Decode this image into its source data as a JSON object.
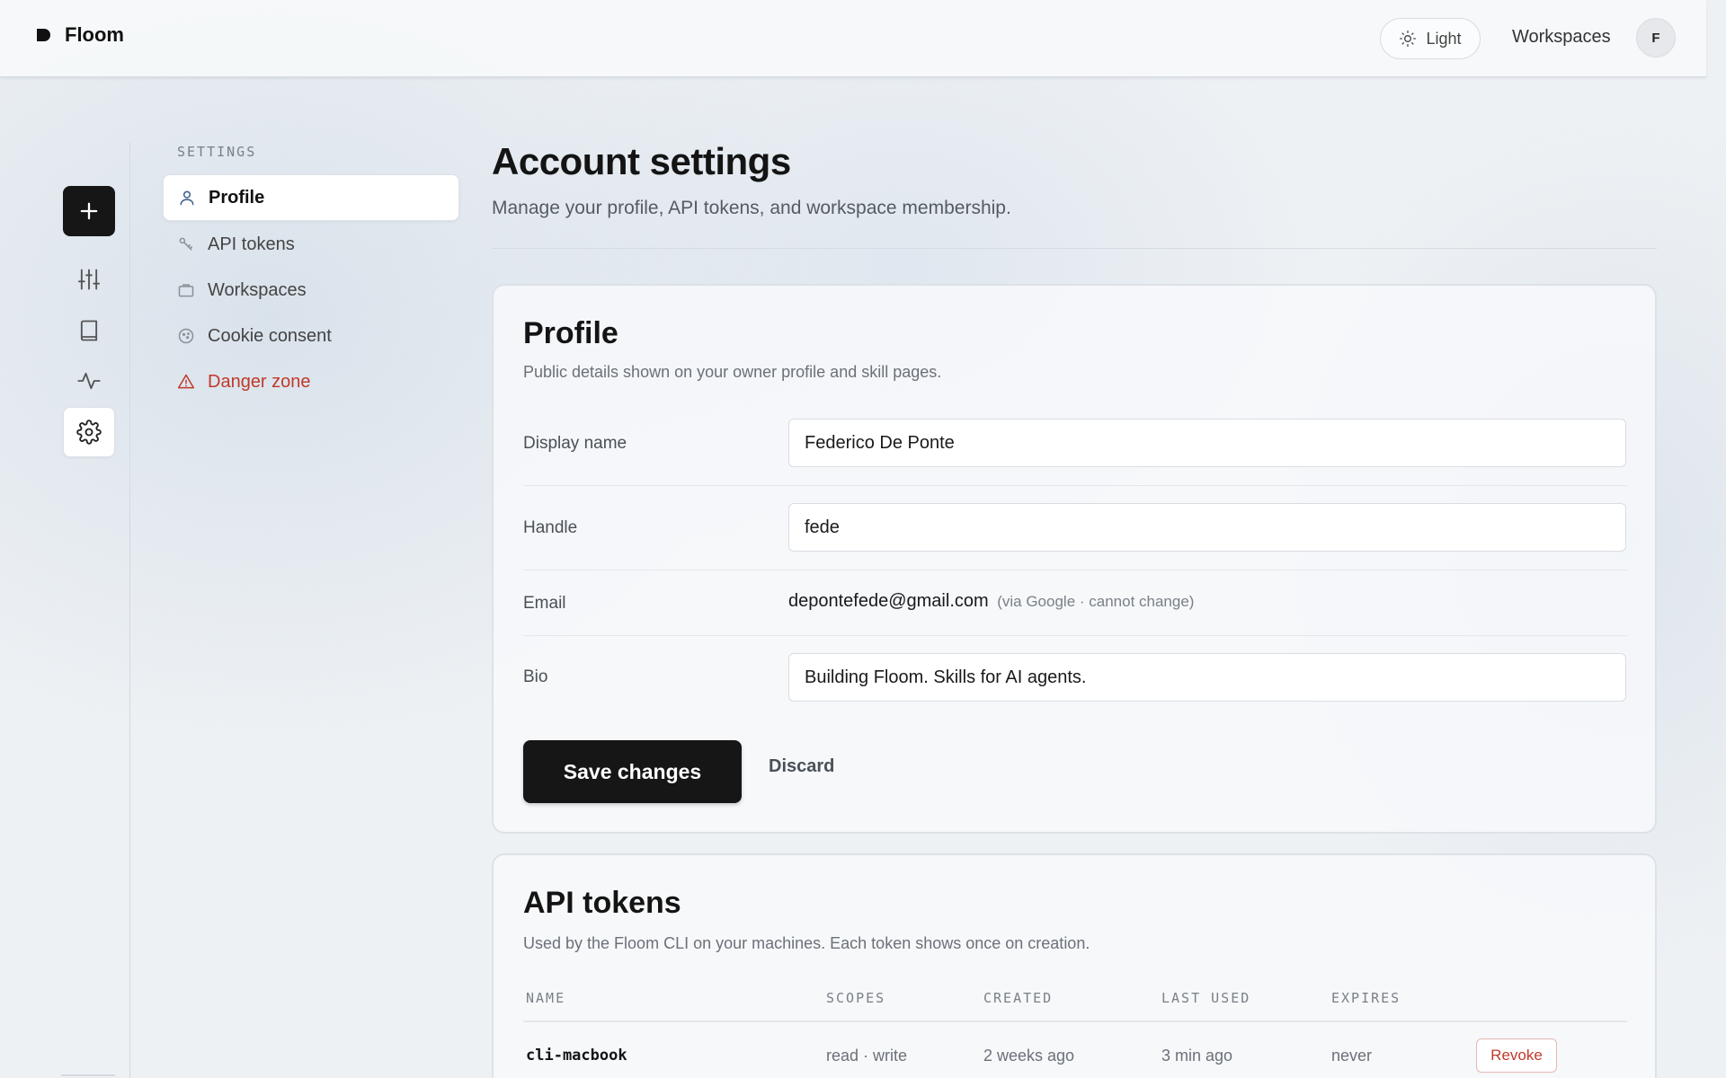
{
  "app": {
    "name": "Floom"
  },
  "topbar": {
    "theme_label": "Light",
    "workspaces_link": "Workspaces",
    "avatar_initial": "F"
  },
  "rail": {
    "items": [
      "new-icon",
      "sliders-icon",
      "book-icon",
      "activity-icon",
      "gear-icon"
    ],
    "active": "gear-icon"
  },
  "settings_nav": {
    "section_label": "SETTINGS",
    "items": [
      {
        "label": "Profile",
        "icon": "user-icon",
        "active": true
      },
      {
        "label": "API tokens",
        "icon": "key-icon"
      },
      {
        "label": "Workspaces",
        "icon": "briefcase-icon"
      },
      {
        "label": "Cookie consent",
        "icon": "cookie-icon"
      },
      {
        "label": "Danger zone",
        "icon": "warning-icon",
        "danger": true
      }
    ]
  },
  "page": {
    "title": "Account settings",
    "subtitle": "Manage your profile, API tokens, and workspace membership."
  },
  "profile": {
    "title": "Profile",
    "subtitle": "Public details shown on your owner profile and skill pages.",
    "display_name_label": "Display name",
    "display_name_value": "Federico De Ponte",
    "handle_label": "Handle",
    "handle_value": "fede",
    "email_label": "Email",
    "email_value": "depontefede@gmail.com",
    "email_note": "(via Google · cannot change)",
    "bio_label": "Bio",
    "bio_value": "Building Floom. Skills for AI agents.",
    "save_label": "Save changes",
    "discard_label": "Discard"
  },
  "tokens": {
    "title": "API tokens",
    "subtitle": "Used by the Floom CLI on your machines. Each token shows once on creation.",
    "columns": [
      "NAME",
      "SCOPES",
      "CREATED",
      "LAST USED",
      "EXPIRES"
    ],
    "rows": [
      {
        "name": "cli-macbook",
        "scopes": "read · write",
        "created": "2 weeks ago",
        "last_used": "3 min ago",
        "expires": "never",
        "action": "Revoke"
      }
    ]
  },
  "colors": {
    "accent": "#161616",
    "danger": "#c0392b",
    "background": "#eef1f4"
  }
}
